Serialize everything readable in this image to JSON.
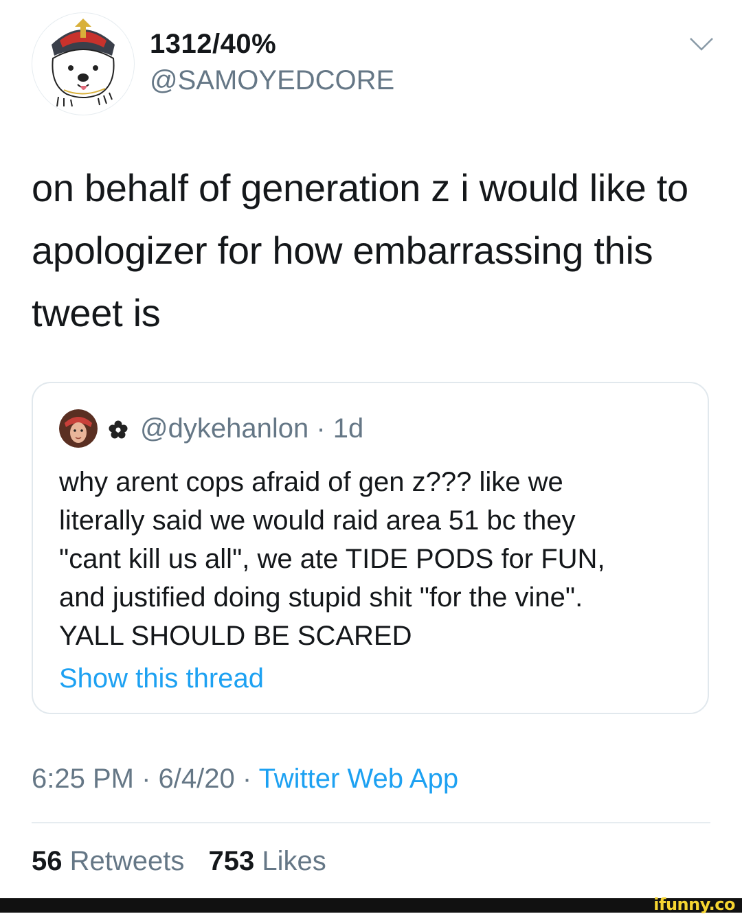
{
  "tweet": {
    "author": {
      "display_name": "1312/40%",
      "handle": "@SAMOYEDCORE",
      "avatar_icon": "samoyed-dog-avatar"
    },
    "menu_icon": "chevron-down-icon",
    "text": "on behalf of generation z i would like to apologizer for how embarrassing this tweet is",
    "quoted_tweet": {
      "avatar_icon": "user-avatar",
      "name_icon": "flower-icon",
      "handle": "@dykehanlon",
      "separator": "·",
      "time": "1d",
      "lines": [
        "why arent cops afraid of gen z??? like we",
        "literally said we would raid area 51 bc they",
        "\"cant kill us all\", we ate TIDE PODS for FUN,",
        "and justified doing stupid shit \"for the vine\".",
        "YALL SHOULD BE SCARED"
      ],
      "show_thread": "Show this thread"
    },
    "meta": {
      "time": "6:25 PM",
      "sep1": " · ",
      "date": "6/4/20",
      "sep2": " · ",
      "source": "Twitter Web App"
    },
    "stats": {
      "retweets_count": "56",
      "retweets_label": "Retweets",
      "likes_count": "753",
      "likes_label": "Likes"
    }
  },
  "watermark": "ifunny.co",
  "colors": {
    "link": "#1da1f2",
    "secondary_text": "#657786",
    "primary_text": "#14171a",
    "border": "#e1e8ed"
  }
}
